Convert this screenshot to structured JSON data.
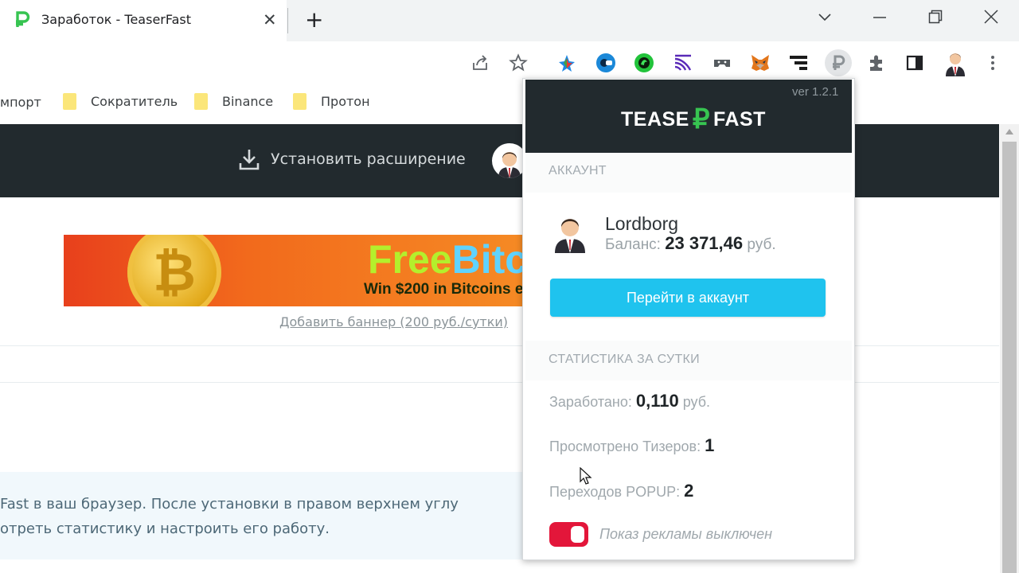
{
  "tab": {
    "title": "Заработок - TeaserFast",
    "close_glyph": "✕",
    "new_tab_glyph": "+"
  },
  "window_controls": {
    "dropdown": "⌄",
    "minimize": "—",
    "restore": "❐",
    "close": "✕"
  },
  "toolbar_icons": [
    "share-icon",
    "star-icon",
    "extension-colorful-icon",
    "extension-blue-circle-icon",
    "extension-green-icon",
    "extension-purple-icon",
    "extension-gray-icon",
    "metamask-fox-icon",
    "extension-bars-icon",
    "teaserfast-ruble-icon",
    "puzzle-icon",
    "side-panel-icon",
    "profile-avatar-icon",
    "more-menu-icon"
  ],
  "bookmarks": {
    "import_label": "мпорт",
    "items": [
      "Сократитель",
      "Binance",
      "Протон"
    ]
  },
  "site": {
    "install_label": "Установить расширение",
    "banner": {
      "title_part1": "Free",
      "title_part2": "Bitco",
      "subtitle": "Win $200 in Bitcoins e",
      "coin_symbol": "₿"
    },
    "add_banner_link": "Добавить баннер (200 руб./сутки)",
    "info_line1": "Fast в ваш браузер. После установки в правом верхнем углу",
    "info_line2": "отреть статистику и настроить его работу."
  },
  "popup": {
    "version": "ver 1.2.1",
    "logo_left": "TEASE",
    "logo_symbol": "₽",
    "logo_right": "FAST",
    "account_section": "АККАУНТ",
    "username": "Lordborg",
    "balance_label": "Баланс:",
    "balance_value": "23 371,46",
    "balance_unit": "руб.",
    "go_account_button": "Перейти в аккаунт",
    "stats_section": "СТАТИСТИКА ЗА СУТКИ",
    "earned_label": "Заработано:",
    "earned_value": "0,110",
    "earned_unit": "руб.",
    "teasers_label": "Просмотрено Тизеров:",
    "teasers_value": "1",
    "popup_label": "Переходов POPUP:",
    "popup_value": "2",
    "ads_toggle_label": "Показ рекламы выключен"
  },
  "colors": {
    "header_dark": "#222a2e",
    "brand_green": "#37c451",
    "button_blue": "#1fc3ee",
    "toggle_red": "#e3163a"
  }
}
